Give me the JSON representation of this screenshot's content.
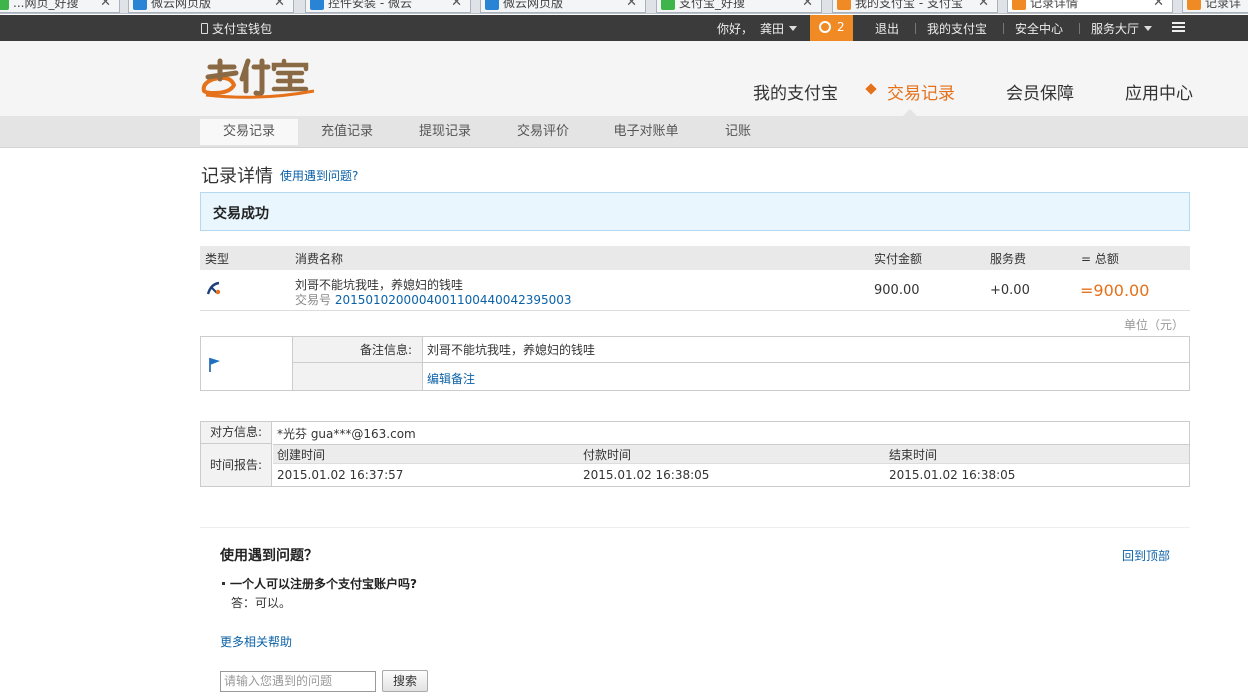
{
  "browser": {
    "tabs": [
      {
        "label": "...网页_好搜",
        "fav": "#3db54a"
      },
      {
        "label": "微云网页版",
        "fav": "#2a84d6"
      },
      {
        "label": "控件安装 - 微云",
        "fav": "#2a84d6"
      },
      {
        "label": "微云网页版",
        "fav": "#2a84d6"
      },
      {
        "label": "支付宝_好搜",
        "fav": "#3db54a"
      },
      {
        "label": "我的支付宝 - 支付宝",
        "fav": "#f08a24"
      },
      {
        "label": "记录详情",
        "fav": "#f08a24"
      },
      {
        "label": "记录详",
        "fav": "#f08a24"
      }
    ]
  },
  "topbar": {
    "wallet": "支付宝钱包",
    "greeting": "你好，",
    "user": "龚田",
    "alarm_count": "2",
    "logout": "退出",
    "my_alipay": "我的支付宝",
    "security": "安全中心",
    "service": "服务大厅"
  },
  "nav": {
    "items": [
      "我的支付宝",
      "交易记录",
      "会员保障",
      "应用中心"
    ],
    "active": "交易记录"
  },
  "subnav": [
    "交易记录",
    "充值记录",
    "提现记录",
    "交易评价",
    "电子对账单",
    "记账"
  ],
  "page": {
    "title": "记录详情",
    "help_link": "使用遇到问题?",
    "status": "交易成功"
  },
  "table": {
    "headers": {
      "type": "类型",
      "name": "消费名称",
      "amount": "实付金额",
      "fee": "服务费",
      "total": "= 总额"
    },
    "row": {
      "name": "刘哥不能坑我哇，养媳妇的钱哇",
      "trade_no_label": "交易号",
      "trade_no": "2015010200004001100440042395003",
      "amount": "900.00",
      "fee": "+0.00",
      "total": "=900.00"
    },
    "unit": "单位（元）"
  },
  "note": {
    "label": "备注信息:",
    "value": "刘哥不能坑我哇，养媳妇的钱哇",
    "edit": "编辑备注"
  },
  "party": {
    "label": "对方信息:",
    "value": "*光芬 gua***@163.com",
    "time_label": "时间报告:",
    "time_headers": [
      "创建时间",
      "付款时间",
      "结束时间"
    ],
    "times": [
      "2015.01.02 16:37:57",
      "2015.01.02 16:38:05",
      "2015.01.02 16:38:05"
    ]
  },
  "faq": {
    "title": "使用遇到问题？",
    "back_top": "回到顶部",
    "question": "一个人可以注册多个支付宝账户吗?",
    "answer": "答：可以。",
    "more": "更多相关帮助",
    "placeholder": "请输入您遇到的问题",
    "search_btn": "搜索"
  },
  "colors": {
    "accent": "#e5711a",
    "link": "#0b62a8",
    "status_bg": "#e9f6fd",
    "topbar": "#3b3b3b"
  }
}
